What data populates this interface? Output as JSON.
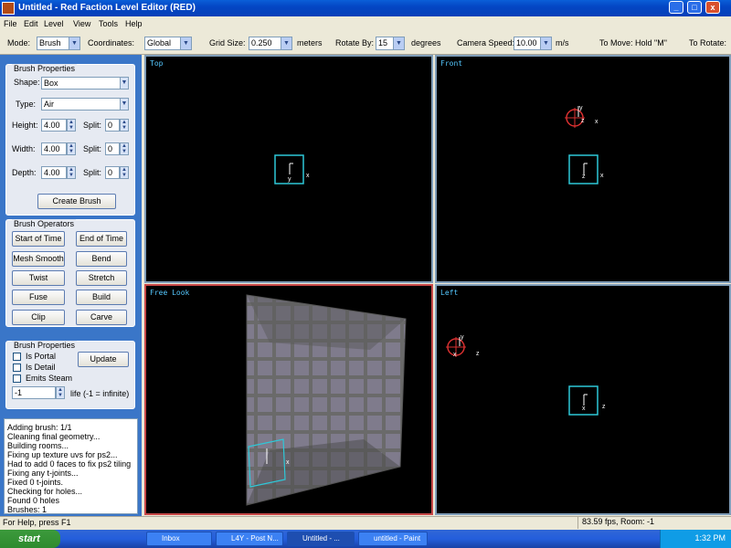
{
  "window": {
    "title": "Untitled - Red Faction Level Editor (RED)",
    "buttons": {
      "min": "_",
      "max": "□",
      "close": "x"
    }
  },
  "menu": [
    "File",
    "Edit",
    "Level",
    "View",
    "Tools",
    "Help"
  ],
  "toolbar": {
    "mode_label": "Mode:",
    "mode_value": "Brush",
    "coords_label": "Coordinates:",
    "coords_value": "Global",
    "grid_label": "Grid Size:",
    "grid_value": "0.250",
    "grid_unit": "meters",
    "rotate_label": "Rotate By:",
    "rotate_value": "15",
    "rotate_unit": "degrees",
    "speed_label": "Camera Speed:",
    "speed_value": "10.00",
    "speed_unit": "m/s",
    "move_hint": "To Move:  Hold \"M\"",
    "rotate_hint": "To Rotate:"
  },
  "brush_properties": {
    "title": "Brush Properties",
    "shape_label": "Shape:",
    "shape_value": "Box",
    "type_label": "Type:",
    "type_value": "Air",
    "height_label": "Height:",
    "height_value": "4.00",
    "width_label": "Width:",
    "width_value": "4.00",
    "depth_label": "Depth:",
    "depth_value": "4.00",
    "split_label": "Split:",
    "split_value": "0",
    "create_button": "Create Brush"
  },
  "brush_operators": {
    "title": "Brush Operators",
    "buttons": [
      "Start of Time",
      "End of Time",
      "Mesh Smooth",
      "Bend",
      "Twist",
      "Stretch",
      "Fuse",
      "Build",
      "Clip",
      "Carve"
    ]
  },
  "brush_flags": {
    "title": "Brush Properties",
    "is_portal": "Is Portal",
    "is_detail": "Is Detail",
    "emits_steam": "Emits Steam",
    "update_button": "Update",
    "life_value": "-1",
    "life_label": "life (-1 = infinite)"
  },
  "log": [
    "Adding brush: 1/1",
    "Cleaning final geometry...",
    "Building rooms...",
    "Fixing up texture uvs for ps2...",
    "Had to add 0 faces to fix ps2 tiling",
    "Fixing any t-joints...",
    "Fixed 0 t-joints.",
    "Checking for holes...",
    "Found 0 holes",
    "Brushes: 1"
  ],
  "viewports": {
    "top": "Top",
    "front": "Front",
    "free": "Free Look",
    "left": "Left"
  },
  "axes": {
    "x": "x",
    "y": "y",
    "z": "z"
  },
  "status": {
    "help": "For Help, press F1",
    "fps": "83.59 fps, Room: -1"
  },
  "taskbar": {
    "start": "start",
    "items": [
      "Inbox",
      "L4Y - Post N...",
      "Untitled - ...",
      "untitled - Paint"
    ],
    "clock": "1:32 PM"
  },
  "colors": {
    "accent": "#3a76c8",
    "viewport_label": "#55c8ff",
    "brush_outline": "#2ec8d8"
  }
}
